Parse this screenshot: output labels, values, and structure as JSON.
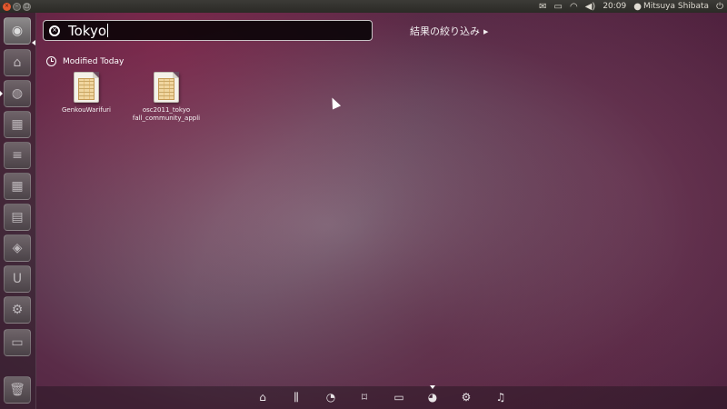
{
  "top_panel": {
    "window_buttons": [
      {
        "name": "close",
        "glyph": "×"
      },
      {
        "name": "minimize",
        "glyph": "–"
      },
      {
        "name": "maximize",
        "glyph": "□"
      }
    ],
    "indicators": {
      "mail_icon": "✉",
      "battery_icon": "▭",
      "wifi_icon": "◠",
      "volume_icon": "◀)",
      "clock": "20:09",
      "user_icon": "●",
      "username": "Mitsuya Shibata",
      "session_icon": "⏻"
    }
  },
  "dash": {
    "search": {
      "value": "Tokyo",
      "clear_glyph": "×"
    },
    "filter_label": "結果の絞り込み",
    "filter_arrow": "▶",
    "category": {
      "label": "Modified Today"
    },
    "results": [
      {
        "label_line1": "GenkouWarifuri",
        "label_line2": ""
      },
      {
        "label_line1": "osc2011_tokyo",
        "label_line2": "fall_community_appli"
      }
    ]
  },
  "launcher": {
    "items": [
      {
        "name": "dash-home",
        "glyph": "◉"
      },
      {
        "name": "home-folder",
        "glyph": "⌂"
      },
      {
        "name": "firefox",
        "glyph": "◍"
      },
      {
        "name": "workspaces",
        "glyph": "▦"
      },
      {
        "name": "writer",
        "glyph": "≡"
      },
      {
        "name": "calc",
        "glyph": "▦"
      },
      {
        "name": "impress",
        "glyph": "▤"
      },
      {
        "name": "software-center",
        "glyph": "◈"
      },
      {
        "name": "ubuntu-one",
        "glyph": "U"
      },
      {
        "name": "system-settings",
        "glyph": "⚙"
      },
      {
        "name": "terminal",
        "glyph": "▭"
      },
      {
        "name": "trash",
        "glyph": "🗑"
      }
    ]
  },
  "lenses": [
    {
      "name": "home",
      "glyph": "⌂"
    },
    {
      "name": "applications",
      "glyph": "⫼"
    },
    {
      "name": "gwibber",
      "glyph": "◔"
    },
    {
      "name": "bookmarks",
      "glyph": "⌑"
    },
    {
      "name": "files",
      "glyph": "▭"
    },
    {
      "name": "photos",
      "glyph": "◕"
    },
    {
      "name": "video",
      "glyph": "⚙"
    },
    {
      "name": "music",
      "glyph": "♫"
    }
  ]
}
